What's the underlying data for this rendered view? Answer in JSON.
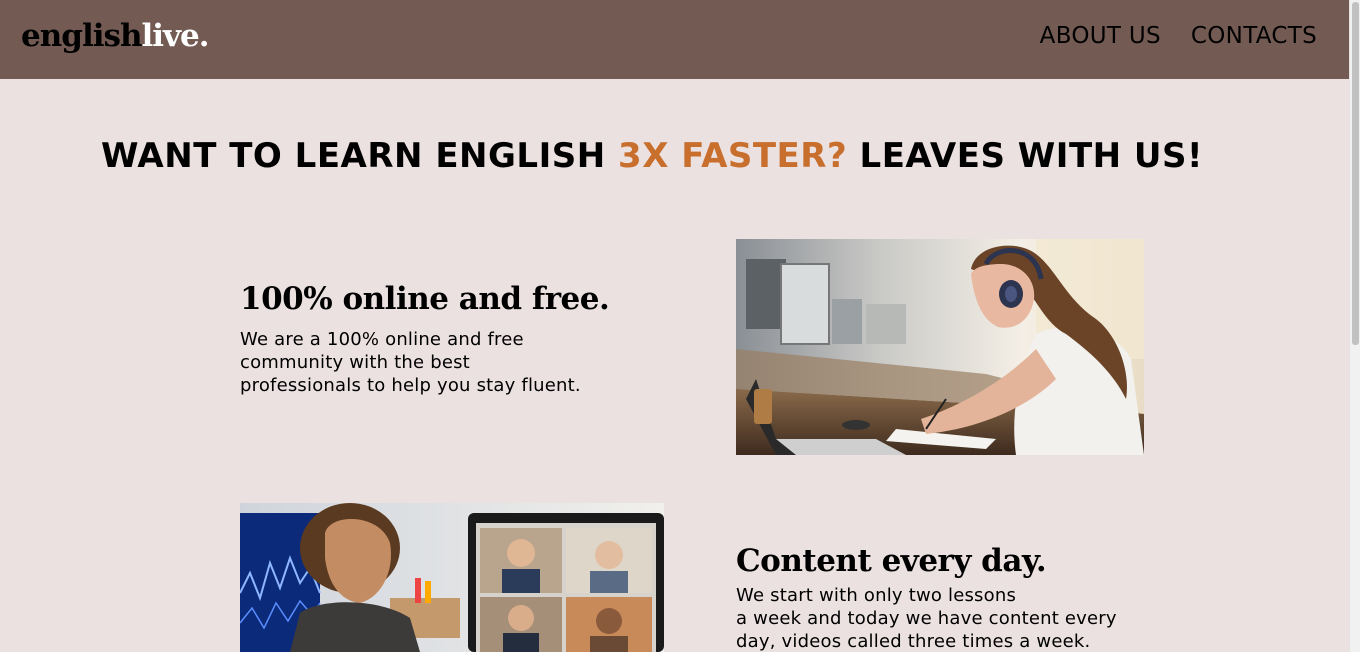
{
  "header": {
    "logo_dark": "english",
    "logo_light": "live.",
    "nav": [
      {
        "label": "ABOUT US"
      },
      {
        "label": "CONTACTS"
      }
    ]
  },
  "hero": {
    "headline_start": "WANT TO LEARN ENGLISH ",
    "headline_accent": "3X FASTER?",
    "headline_end": " LEAVES WITH US!"
  },
  "features": [
    {
      "title": "100% online and free.",
      "lines": [
        "We are a 100% online and free",
        "community with the best",
        "professionals to help you stay fluent."
      ]
    },
    {
      "title": "Content every day.",
      "lines": [
        "We start with only two lessons",
        "a week and today we have content every",
        "day, videos called three times a week."
      ]
    }
  ],
  "colors": {
    "header_bg": "#735b53",
    "page_bg": "#ebe1e1",
    "accent": "#c86f2e"
  }
}
